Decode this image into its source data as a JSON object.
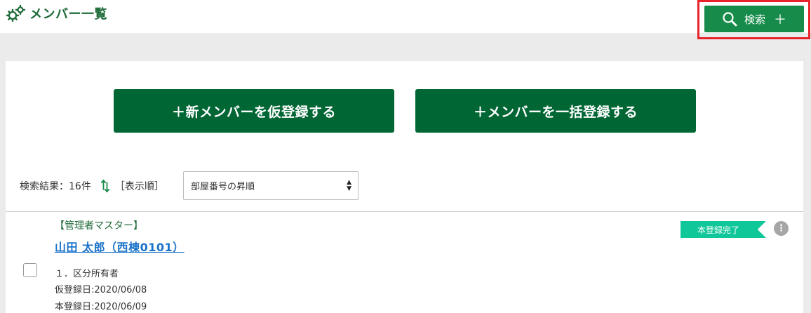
{
  "header": {
    "title": "メンバー一覧",
    "search_label": "検索",
    "search_plus": "＋"
  },
  "actions": {
    "provisional_register": "＋新メンバーを仮登録する",
    "bulk_register": "＋メンバーを一括登録する"
  },
  "results": {
    "count_label": "検索結果：16件",
    "sort_label": "［表示順］",
    "sort_selected": "部屋番号の昇順"
  },
  "members": [
    {
      "role": "【管理者マスター】",
      "name": "山田 太郎（西棟0101）",
      "status": "本登録完了",
      "category": "１．区分所有者",
      "provisional_date": "仮登録日:2020/06/08",
      "registered_date": "本登録日:2020/06/09"
    }
  ],
  "colors": {
    "brand_green": "#006634",
    "search_green": "#178c4a",
    "title_green": "#1e6a38",
    "status_teal": "#10c79a",
    "link_blue": "#1a73c9",
    "highlight_red": "#e8232b"
  },
  "icons": [
    "gear-icon",
    "search-icon",
    "sort-icon",
    "more-icon",
    "select-arrows-icon"
  ]
}
